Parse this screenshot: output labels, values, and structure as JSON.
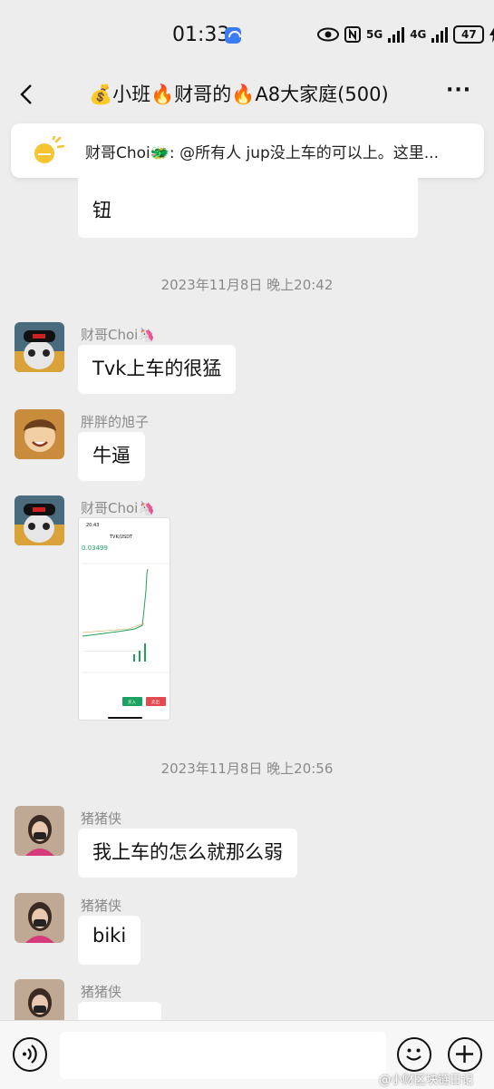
{
  "status_bar": {
    "time": "01:33",
    "signal1_label": "5G",
    "signal2_label": "4G",
    "battery": "47"
  },
  "header": {
    "title": "💰小班🔥财哥的🔥A8大家庭(500)"
  },
  "notice": {
    "text": "财哥Choi🐲: @所有人 jup没上车的可以上。这里..."
  },
  "messages": {
    "partial_text": "钮",
    "timestamp1": "2023年11月8日 晚上20:42",
    "m1_sender": "财哥Choi🦄",
    "m1_text": "Tvk上车的很猛",
    "m2_sender": "胖胖的旭子",
    "m2_text": "牛逼",
    "m3_sender": "财哥Choi🦄",
    "timestamp2": "2023年11月8日 晚上20:56",
    "m4_sender": "猪猪侠",
    "m4_text": "我上车的怎么就那么弱",
    "m5_sender": "猪猪侠",
    "m5_text": "biki",
    "m6_sender": "猪猪侠"
  },
  "screenshot_image": {
    "time": "20:43",
    "pair": "TVK/USDT",
    "price": "0.03499",
    "buy": "买入",
    "sell": "卖出"
  },
  "watermark": "@小财区块链日记",
  "colors": {
    "background": "#ededed",
    "bubble": "#ffffff",
    "timestamp": "#8a8a8a"
  }
}
